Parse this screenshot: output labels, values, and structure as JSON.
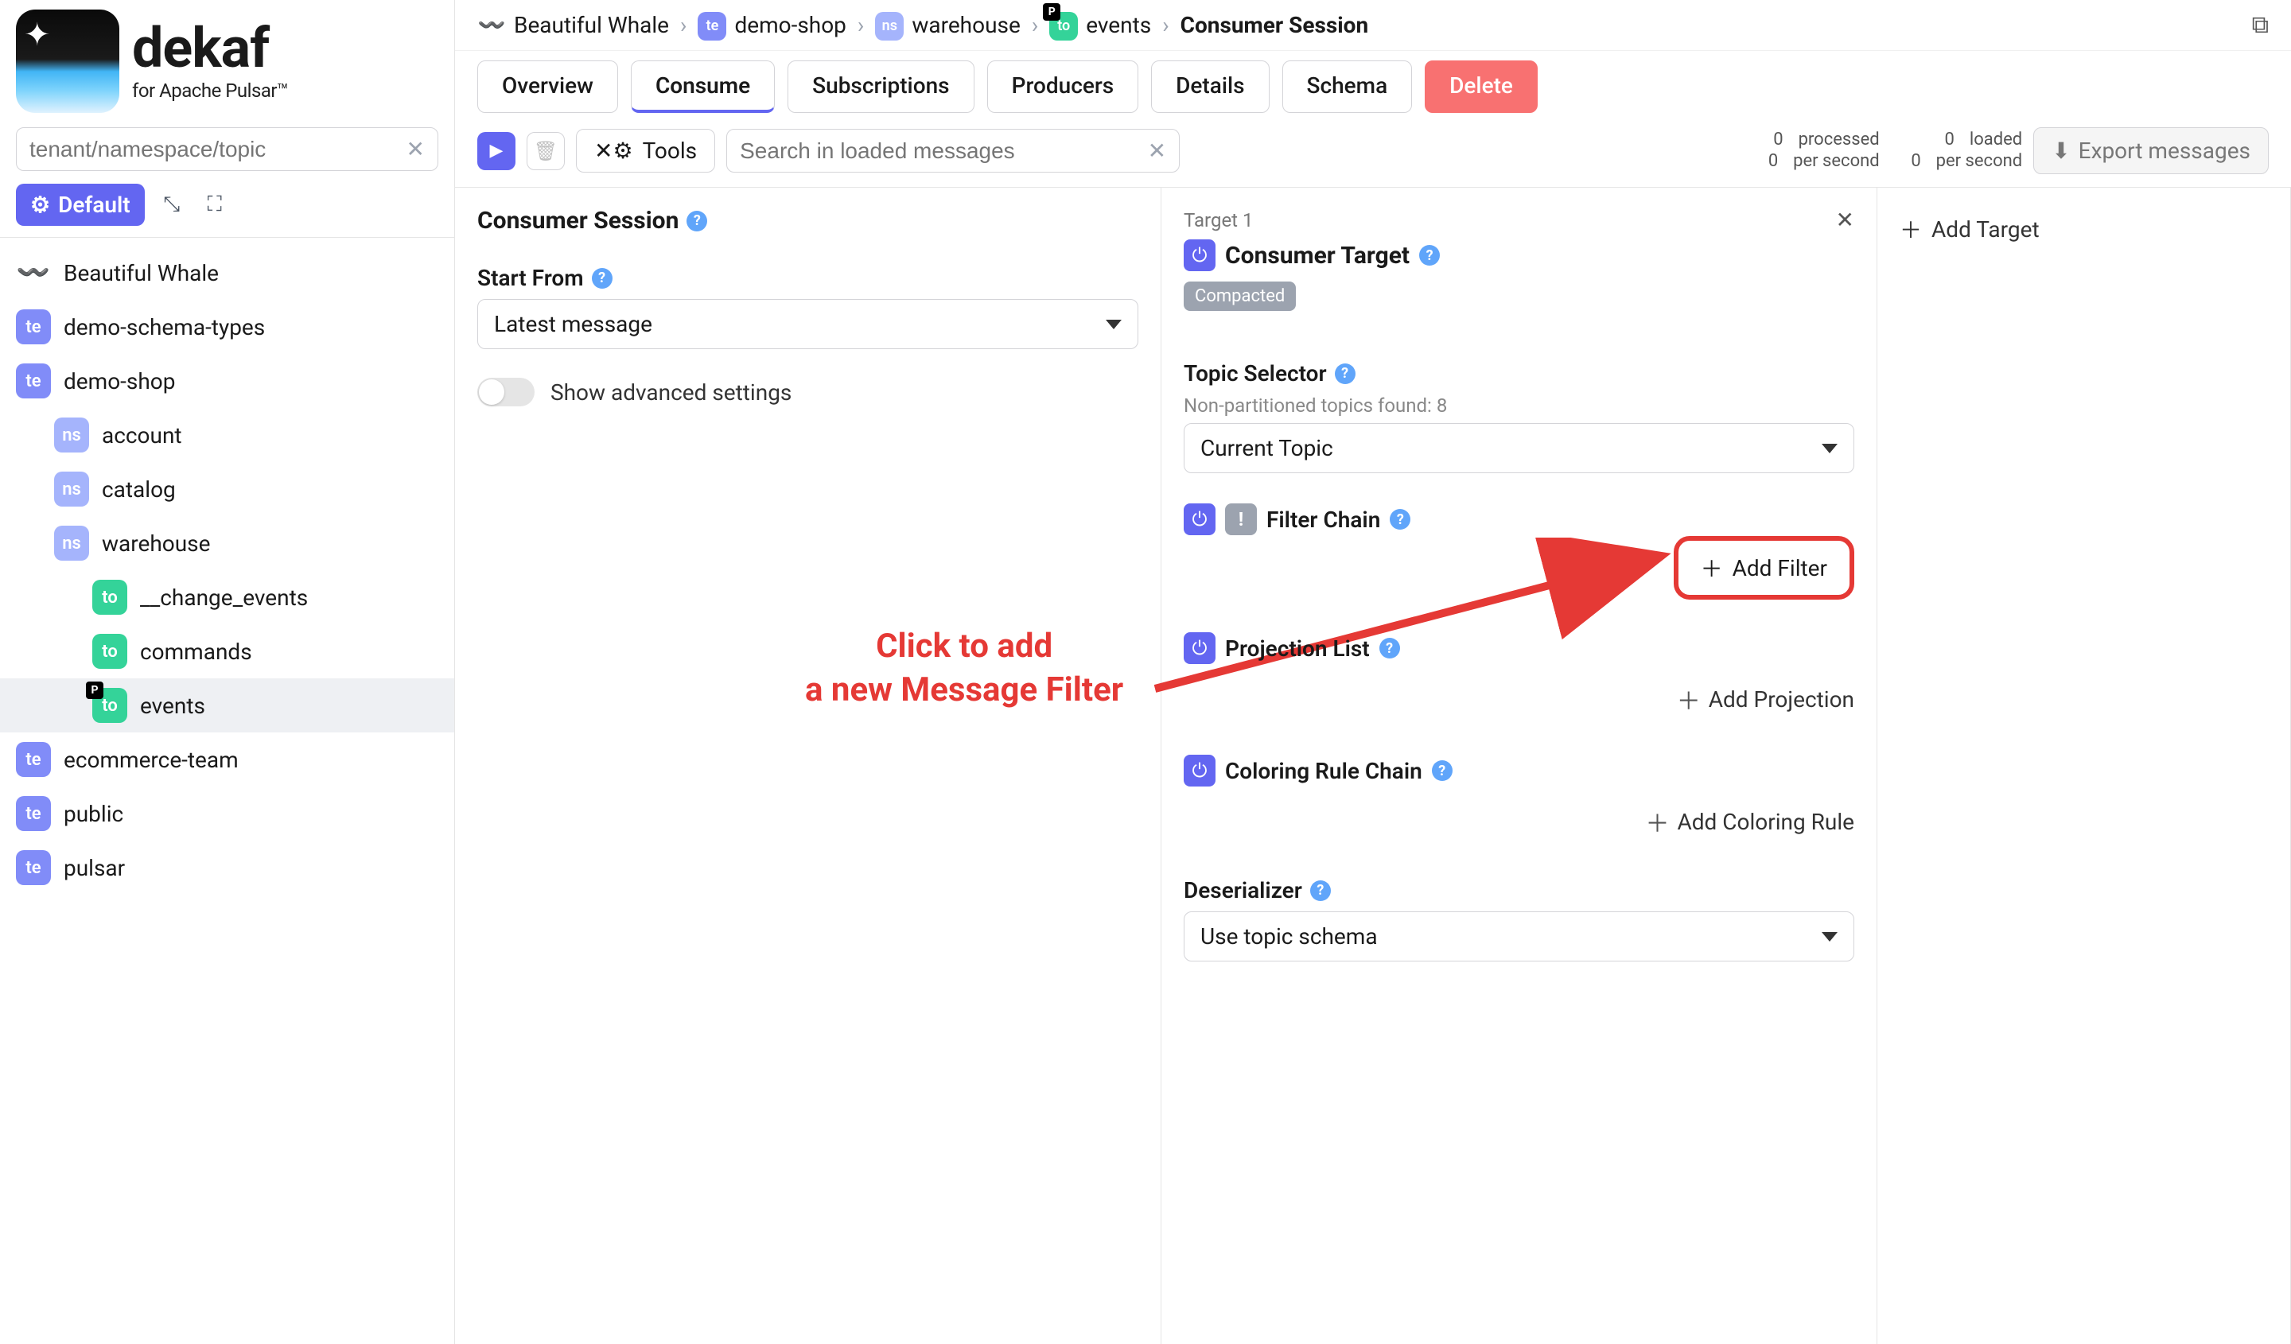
{
  "logo": {
    "title": "dekaf",
    "subtitle": "for Apache Pulsar™"
  },
  "sidebar": {
    "search_placeholder": "tenant/namespace/topic",
    "profile_label": "Default",
    "tree": [
      {
        "type": "whale",
        "label": "Beautiful Whale"
      },
      {
        "type": "te",
        "label": "demo-schema-types"
      },
      {
        "type": "te",
        "label": "demo-shop"
      },
      {
        "type": "ns",
        "label": "account",
        "indent": 1
      },
      {
        "type": "ns",
        "label": "catalog",
        "indent": 1
      },
      {
        "type": "ns",
        "label": "warehouse",
        "indent": 1
      },
      {
        "type": "to",
        "label": "__change_events",
        "indent": 2
      },
      {
        "type": "to",
        "label": "commands",
        "indent": 2
      },
      {
        "type": "to",
        "label": "events",
        "indent": 2,
        "p": true,
        "selected": true
      },
      {
        "type": "te",
        "label": "ecommerce-team"
      },
      {
        "type": "te",
        "label": "public"
      },
      {
        "type": "te",
        "label": "pulsar"
      }
    ]
  },
  "breadcrumb": {
    "items": [
      {
        "type": "whale",
        "label": "Beautiful Whale"
      },
      {
        "type": "te",
        "label": "demo-shop"
      },
      {
        "type": "ns",
        "label": "warehouse"
      },
      {
        "type": "to",
        "label": "events",
        "p": true
      },
      {
        "type": "current",
        "label": "Consumer Session"
      }
    ]
  },
  "tabs": [
    {
      "label": "Overview"
    },
    {
      "label": "Consume",
      "active": true
    },
    {
      "label": "Subscriptions"
    },
    {
      "label": "Producers"
    },
    {
      "label": "Details"
    },
    {
      "label": "Schema"
    },
    {
      "label": "Delete",
      "danger": true
    }
  ],
  "toolbar": {
    "tools_label": "Tools",
    "msg_search_placeholder": "Search in loaded messages",
    "stats": {
      "processed_n": "0",
      "processed_label": "processed",
      "processed_ps_n": "0",
      "processed_ps_label": "per second",
      "loaded_n": "0",
      "loaded_label": "loaded",
      "loaded_ps_n": "0",
      "loaded_ps_label": "per second"
    },
    "export_label": "Export messages"
  },
  "session": {
    "title": "Consumer Session",
    "start_from_label": "Start From",
    "start_from_value": "Latest message",
    "advanced_label": "Show advanced settings"
  },
  "target": {
    "header": "Target 1",
    "title": "Consumer Target",
    "chip": "Compacted",
    "topic_selector_label": "Topic Selector",
    "topics_found": "Non-partitioned topics found: 8",
    "topic_value": "Current Topic",
    "filter_chain_label": "Filter Chain",
    "add_filter_label": "Add Filter",
    "projection_label": "Projection List",
    "add_projection_label": "Add Projection",
    "coloring_label": "Coloring Rule Chain",
    "add_coloring_label": "Add Coloring Rule",
    "deserializer_label": "Deserializer",
    "deserializer_value": "Use topic schema"
  },
  "add_target_label": "Add Target",
  "annotation_line1": "Click to add",
  "annotation_line2": "a new Message Filter"
}
